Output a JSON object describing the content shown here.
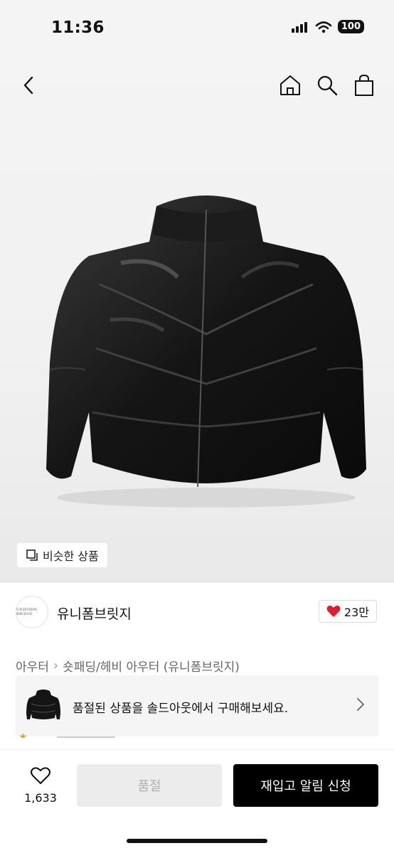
{
  "status_bar": {
    "time": "11:36",
    "battery": "100"
  },
  "nav": {
    "back_icon": "chevron-left-icon",
    "icons": [
      "home-icon",
      "search-icon",
      "bag-icon"
    ]
  },
  "hero": {
    "similar_label": "비슷한 상품"
  },
  "brand": {
    "logo_text": "UNIFORM BRIDGE",
    "name": "유니폼브릿지",
    "likes": "23만"
  },
  "breadcrumb": {
    "category": "아우터",
    "subcategory": "숏패딩/헤비 아우터 (유니폼브릿지)"
  },
  "soldout_banner": {
    "text": "품절된 상품을 솔드아웃에서 구매해보세요."
  },
  "bottom_bar": {
    "wish_count": "1,633",
    "soldout_label": "품절",
    "restock_label": "재입고 알림 신청"
  },
  "colors": {
    "accent": "#000000",
    "heart": "#e01e2b",
    "background": "#f2f2f2"
  }
}
